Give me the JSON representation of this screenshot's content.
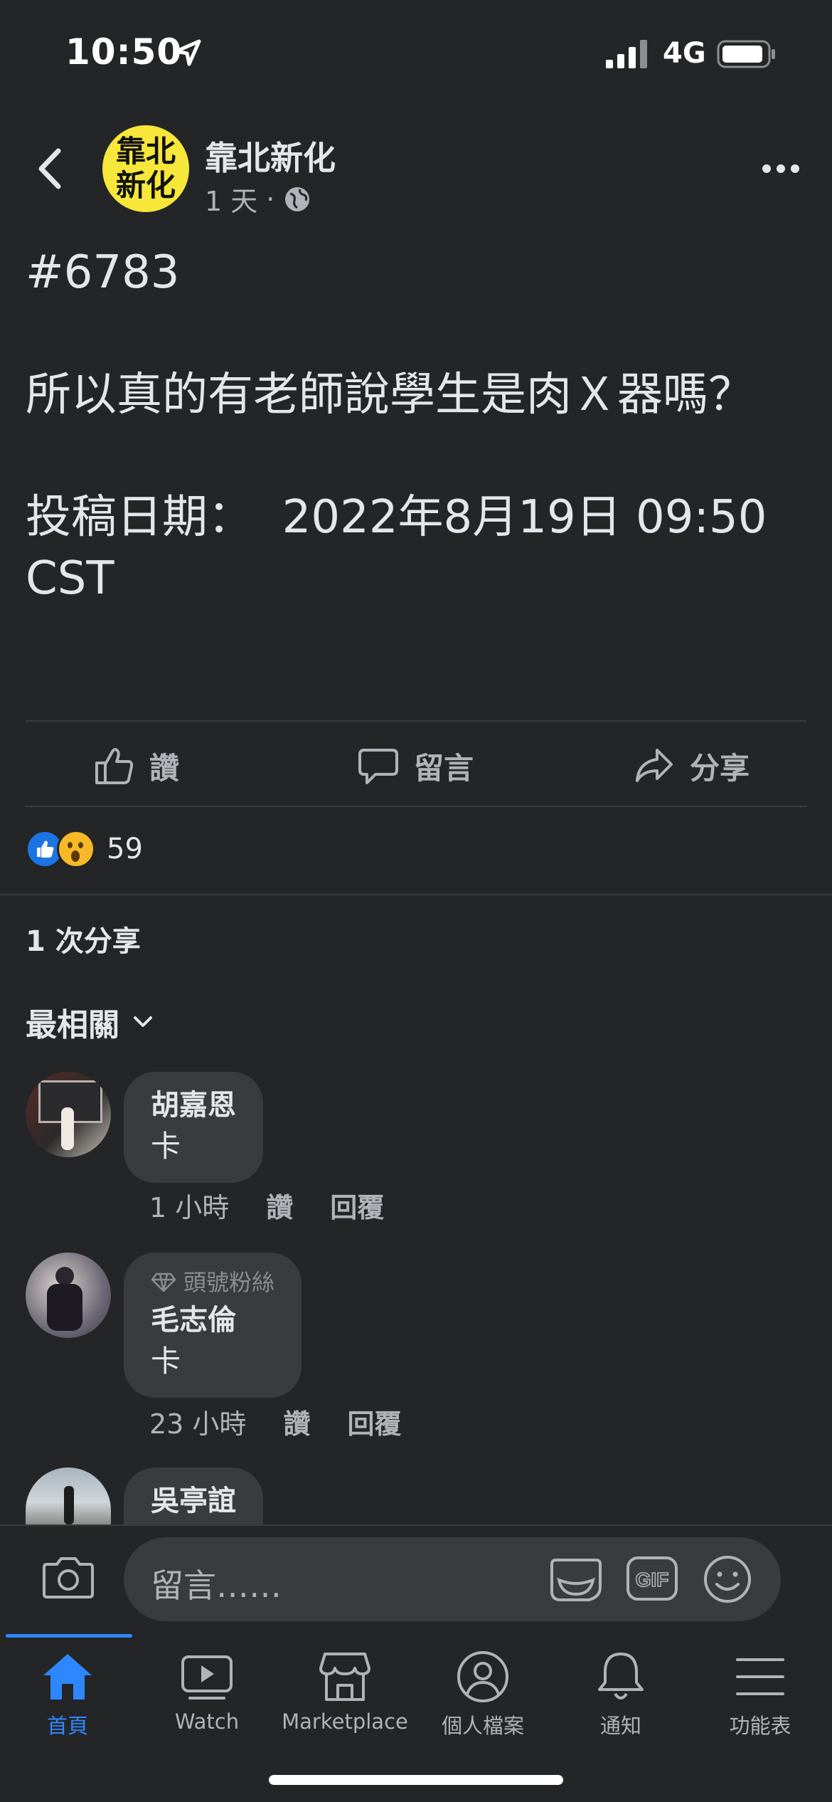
{
  "status_bar": {
    "time": "10:50",
    "network": "4G"
  },
  "header": {
    "page_name": "靠北新化",
    "time_ago": "1 天",
    "separator": "·",
    "avatar_line1": "靠北",
    "avatar_line2": "新化"
  },
  "post": {
    "text": "#6783\n\n所以真的有老師說學生是肉Ｘ器嗎？\n\n投稿日期：  2022年8月19日 09:50 CST"
  },
  "actions": {
    "like": "讚",
    "comment": "留言",
    "share": "分享"
  },
  "reactions": {
    "count": "59"
  },
  "shares": "1 次分享",
  "sort_label": "最相關",
  "comments": [
    {
      "name": "胡嘉恩",
      "text": "卡",
      "time": "1 小時",
      "like": "讚",
      "reply": "回覆"
    },
    {
      "badge": "頭號粉絲",
      "name": "毛志倫",
      "text": "卡",
      "time": "23 小時",
      "like": "讚",
      "reply": "回覆"
    },
    {
      "name": "吳亭誼"
    }
  ],
  "composer": {
    "placeholder": "留言……"
  },
  "tabs": [
    {
      "label": "首頁",
      "icon": "home-icon"
    },
    {
      "label": "Watch",
      "icon": "watch-icon"
    },
    {
      "label": "Marketplace",
      "icon": "marketplace-icon"
    },
    {
      "label": "個人檔案",
      "icon": "profile-icon"
    },
    {
      "label": "通知",
      "icon": "bell-icon"
    },
    {
      "label": "功能表",
      "icon": "menu-icon"
    }
  ],
  "colors": {
    "background": "#242527",
    "accent": "#2d88ff",
    "avatar_bg": "#f7e73a"
  }
}
